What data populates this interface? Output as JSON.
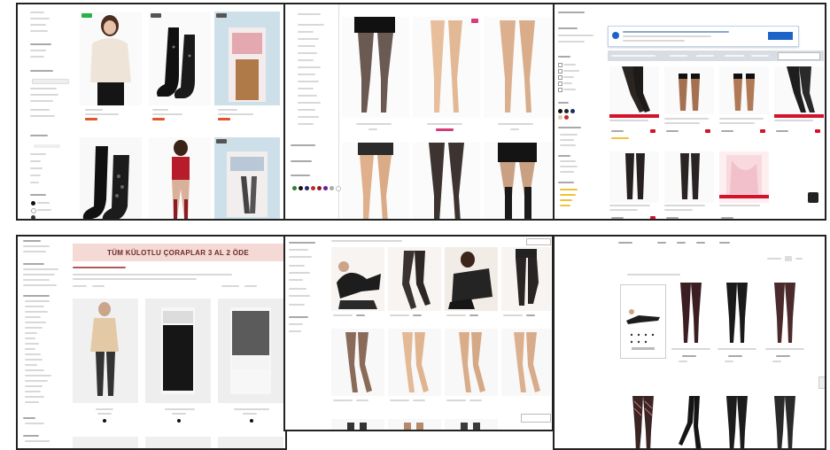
{
  "collage": {
    "panel_count": 6,
    "panels": [
      {
        "name": "shop-1",
        "theme": "hosiery category grid with sidebar filters"
      },
      {
        "name": "shop-2",
        "theme": "tights product grid"
      },
      {
        "name": "shop-3",
        "theme": "stockings grid with notification popup"
      },
      {
        "name": "shop-4",
        "theme": "campaign banner and socks grid"
      },
      {
        "name": "shop-5",
        "theme": "tights photo grid"
      },
      {
        "name": "shop-6",
        "theme": "stockings grid with promo card"
      }
    ]
  },
  "shop3": {
    "popup_button_label": "",
    "tile_legs": [
      "black",
      "black",
      "black",
      "black",
      "black",
      "black",
      "pink"
    ]
  },
  "shop4": {
    "banner_text": "TÜM KÜLOTLU ÇORAPLAR 3 AL 2 ÖDE"
  },
  "colors": {
    "accent_red": "#d4122a",
    "price_orange": "#e0542e",
    "banner_pink": "#f5d9d5",
    "popup_blue": "#1e64c8",
    "new_badge_green": "#26b34a",
    "frame": "#222222"
  },
  "swatches": [
    "#2e7d32",
    "#111111",
    "#1b2b6b",
    "#c62828",
    "#8a1b2b",
    "#6a1b9a",
    "#aaaaaa",
    "#ffffff"
  ]
}
